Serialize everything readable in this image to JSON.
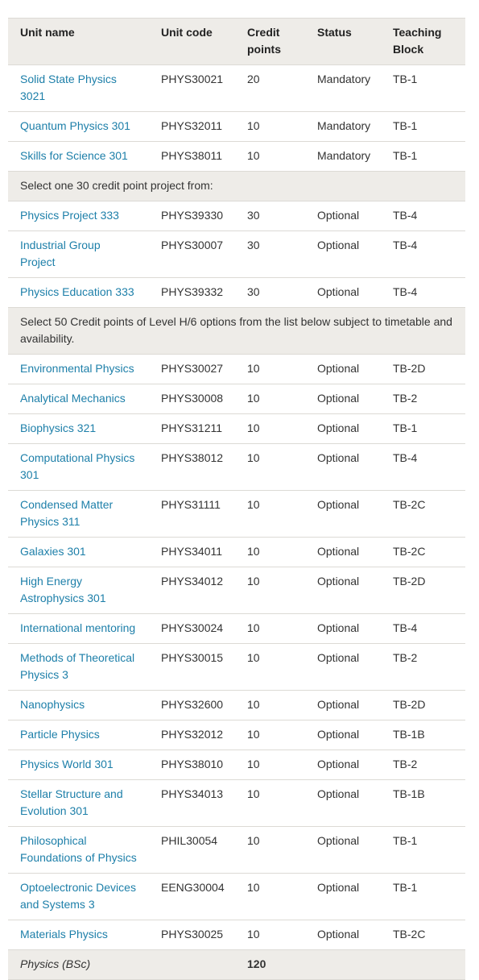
{
  "table": {
    "headers": [
      "Unit name",
      "Unit code",
      "Credit points",
      "Status",
      "Teaching Block"
    ],
    "rows": [
      {
        "name": "Solid State Physics 3021",
        "code": "PHYS30021",
        "credit": "20",
        "status": "Mandatory",
        "block": "TB-1"
      },
      {
        "name": "Quantum Physics 301",
        "code": "PHYS32011",
        "credit": "10",
        "status": "Mandatory",
        "block": "TB-1"
      },
      {
        "name": "Skills for Science 301",
        "code": "PHYS38011",
        "credit": "10",
        "status": "Mandatory",
        "block": "TB-1"
      },
      {
        "group": "Select one 30 credit point project from:"
      },
      {
        "name": "Physics Project 333",
        "code": "PHYS39330",
        "credit": "30",
        "status": "Optional",
        "block": "TB-4"
      },
      {
        "name": "Industrial Group Project",
        "code": "PHYS30007",
        "credit": "30",
        "status": "Optional",
        "block": "TB-4"
      },
      {
        "name": "Physics Education 333",
        "code": "PHYS39332",
        "credit": "30",
        "status": "Optional",
        "block": "TB-4"
      },
      {
        "group": "Select 50 Credit points of Level H/6 options from the list below subject to timetable and availability."
      },
      {
        "name": "Environmental Physics",
        "code": "PHYS30027",
        "credit": "10",
        "status": "Optional",
        "block": "TB-2D"
      },
      {
        "name": "Analytical Mechanics",
        "code": "PHYS30008",
        "credit": "10",
        "status": "Optional",
        "block": "TB-2"
      },
      {
        "name": "Biophysics 321",
        "code": "PHYS31211",
        "credit": "10",
        "status": "Optional",
        "block": "TB-1"
      },
      {
        "name": "Computational Physics 301",
        "code": "PHYS38012",
        "credit": "10",
        "status": "Optional",
        "block": "TB-4"
      },
      {
        "name": "Condensed Matter Physics 311",
        "code": "PHYS31111",
        "credit": "10",
        "status": "Optional",
        "block": "TB-2C"
      },
      {
        "name": "Galaxies 301",
        "code": "PHYS34011",
        "credit": "10",
        "status": "Optional",
        "block": "TB-2C"
      },
      {
        "name": "High Energy Astrophysics 301",
        "code": "PHYS34012",
        "credit": "10",
        "status": "Optional",
        "block": "TB-2D"
      },
      {
        "name": "International mentoring",
        "code": "PHYS30024",
        "credit": "10",
        "status": "Optional",
        "block": "TB-4"
      },
      {
        "name": "Methods of Theoretical Physics 3",
        "code": "PHYS30015",
        "credit": "10",
        "status": "Optional",
        "block": "TB-2"
      },
      {
        "name": "Nanophysics",
        "code": "PHYS32600",
        "credit": "10",
        "status": "Optional",
        "block": "TB-2D"
      },
      {
        "name": "Particle Physics",
        "code": "PHYS32012",
        "credit": "10",
        "status": "Optional",
        "block": "TB-1B"
      },
      {
        "name": "Physics World 301",
        "code": "PHYS38010",
        "credit": "10",
        "status": "Optional",
        "block": "TB-2"
      },
      {
        "name": "Stellar Structure and Evolution 301",
        "code": "PHYS34013",
        "credit": "10",
        "status": "Optional",
        "block": "TB-1B"
      },
      {
        "name": "Philosophical Foundations of Physics",
        "code": "PHIL30054",
        "credit": "10",
        "status": "Optional",
        "block": "TB-1"
      },
      {
        "name": "Optoelectronic Devices and Systems 3",
        "code": "EENG30004",
        "credit": "10",
        "status": "Optional",
        "block": "TB-1"
      },
      {
        "name": "Materials Physics",
        "code": "PHYS30025",
        "credit": "10",
        "status": "Optional",
        "block": "TB-2C"
      }
    ],
    "total": {
      "name": "Physics (BSc)",
      "credit": "120"
    }
  },
  "colors": {
    "link": "#1d7fa9",
    "header_bg": "#eeece8",
    "border": "#dcdad5"
  }
}
